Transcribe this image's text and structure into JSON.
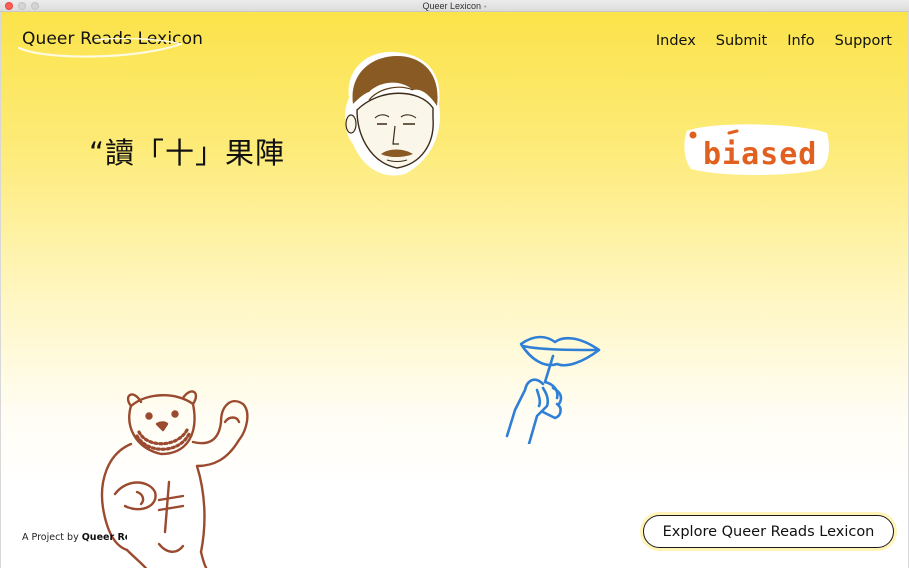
{
  "window": {
    "title": "Queer Lexicon",
    "edited_marker": "•"
  },
  "header": {
    "brand": "Queer Reads Lexicon",
    "nav": [
      "Index",
      "Submit",
      "Info",
      "Support"
    ]
  },
  "hero": {
    "quote": "“讀「十」果陣",
    "sticker_text": "biased"
  },
  "footer": {
    "credit_prefix": "A Project by",
    "credit_link": "Queer Re",
    "cta": "Explore Queer Reads Lexicon"
  },
  "colors": {
    "accent_yellow": "#fbe34a",
    "sticker_orange": "#e2601f",
    "hand_blue": "#2f7fd6",
    "bear_brown": "#9a4a2e",
    "face_brown": "#8a5a24"
  },
  "illustrations": [
    "face-illustration",
    "biased-sticker",
    "hand-with-lips-illustration",
    "bear-illustration"
  ]
}
